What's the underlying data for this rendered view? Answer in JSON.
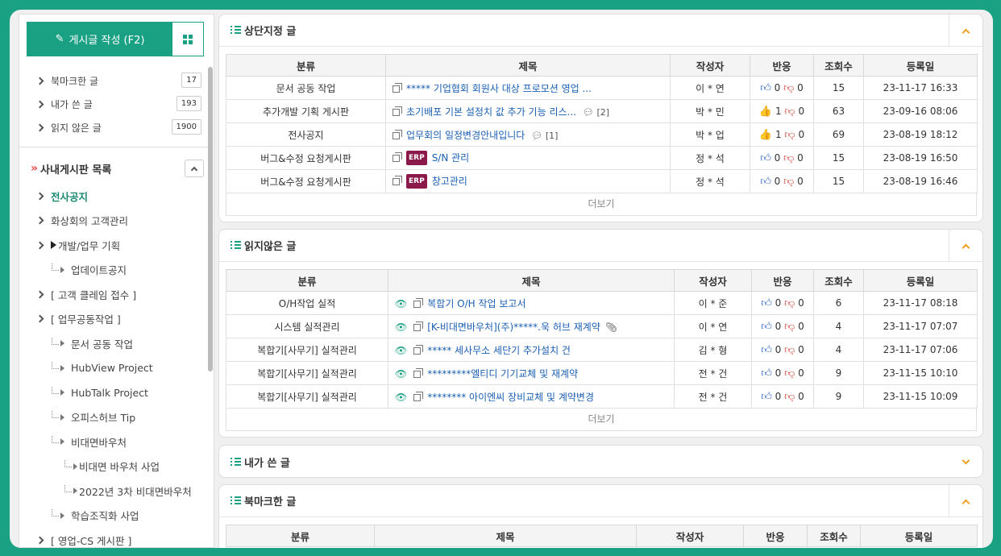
{
  "sidebar": {
    "write_button": "게시글 작성 (F2)",
    "quick": [
      {
        "label": "북마크한 글",
        "count": "17"
      },
      {
        "label": "내가 쓴 글",
        "count": "193"
      },
      {
        "label": "읽지 않은 글",
        "count": "1900"
      }
    ],
    "board_title": "사내게시판 목록",
    "tree": [
      {
        "label": "전사공지"
      },
      {
        "label": "화상회의 고객관리"
      },
      {
        "label": "개발/업무 기획"
      },
      {
        "label": "업데이트공지"
      },
      {
        "label": "[ 고객 클레임 접수 ]"
      },
      {
        "label": "[ 업무공동작업 ]"
      },
      {
        "label": "문서 공동 작업"
      },
      {
        "label": "HubView Project"
      },
      {
        "label": "HubTalk Project"
      },
      {
        "label": "오피스허브 Tip"
      },
      {
        "label": "비대면바우처"
      },
      {
        "label": "비대면 바우처 사업"
      },
      {
        "label": "2022년 3차 비대면바우처"
      },
      {
        "label": "학습조직화 사업"
      },
      {
        "label": "[ 영업-CS 게시판 ]"
      }
    ]
  },
  "columns": {
    "category": "분류",
    "title": "제목",
    "author": "작성자",
    "reaction": "반응",
    "views": "조회수",
    "date": "등록일"
  },
  "more_label": "더보기",
  "pinned": {
    "title": "상단지정 글",
    "rows": [
      {
        "category": "문서 공동 작업",
        "title": "***** 기업협회 회원사 대상 프로모션 영업 ...",
        "comment": "",
        "author": "이 * 연",
        "up": "0",
        "down": "0",
        "views": "15",
        "date": "23-11-17 16:33"
      },
      {
        "category": "추가개발 기획 게시판",
        "title": "초기배포 기본 설정치 값 추가 기능 리스...",
        "comment": "[2]",
        "author": "박 * 민",
        "up": "1",
        "down": "0",
        "views": "63",
        "date": "23-09-16 08:06"
      },
      {
        "category": "전사공지",
        "title": "업무회의 일정변경안내입니다",
        "comment": "[1]",
        "author": "박 * 업",
        "up": "1",
        "down": "0",
        "views": "69",
        "date": "23-08-19 18:12"
      },
      {
        "category": "버그&수정 요청게시판",
        "badge": "ERP",
        "title": "S/N 관리",
        "comment": "",
        "author": "정 * 석",
        "up": "0",
        "down": "0",
        "views": "15",
        "date": "23-08-19 16:50"
      },
      {
        "category": "버그&수정 요청게시판",
        "badge": "ERP",
        "title": "창고관리",
        "comment": "",
        "author": "정 * 석",
        "up": "0",
        "down": "0",
        "views": "15",
        "date": "23-08-19 16:46"
      }
    ]
  },
  "unread": {
    "title": "읽지않은 글",
    "rows": [
      {
        "category": "O/H작업 실적",
        "title": "복합기 O/H 작업 보고서",
        "author": "이 * 준",
        "up": "0",
        "down": "0",
        "views": "6",
        "date": "23-11-17 08:18"
      },
      {
        "category": "시스템 실적관리",
        "title": "[K-비대면바우처](주)*****.욱 허브 재계약",
        "author": "이 * 연",
        "up": "0",
        "down": "0",
        "views": "4",
        "date": "23-11-17 07:07"
      },
      {
        "category": "복합기[사무기] 실적관리",
        "title": "***** 세사무소 세단기 추가설치 건",
        "author": "김 * 형",
        "up": "0",
        "down": "0",
        "views": "4",
        "date": "23-11-17 07:06"
      },
      {
        "category": "복합기[사무기] 실적관리",
        "title": "*********엘티디 기기교체 및 재계약",
        "author": "전 * 건",
        "up": "0",
        "down": "0",
        "views": "9",
        "date": "23-11-15 10:10"
      },
      {
        "category": "복합기[사무기] 실적관리",
        "title": "******** 아이엔씨 장비교체 및 계약변경",
        "author": "전 * 건",
        "up": "0",
        "down": "0",
        "views": "9",
        "date": "23-11-15 10:09"
      }
    ]
  },
  "mine": {
    "title": "내가 쓴 글"
  },
  "bookmark": {
    "title": "북마크한 글"
  },
  "colors": {
    "accent": "#1aa184",
    "toggle": "#f0a020",
    "erp": "#8b1a4a"
  }
}
